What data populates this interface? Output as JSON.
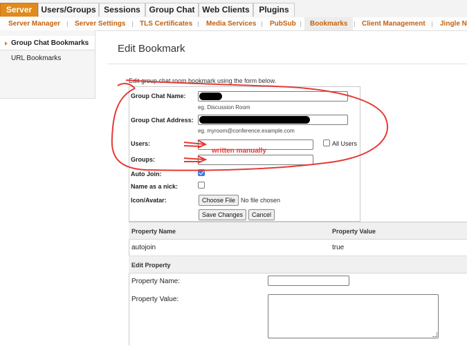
{
  "top_tabs": [
    {
      "label": "Server",
      "active": true
    },
    {
      "label": "Users/Groups",
      "active": false
    },
    {
      "label": "Sessions",
      "active": false
    },
    {
      "label": "Group Chat",
      "active": false
    },
    {
      "label": "Web Clients",
      "active": false
    },
    {
      "label": "Plugins",
      "active": false
    }
  ],
  "sub_tabs": [
    {
      "label": "Server Manager"
    },
    {
      "label": "Server Settings"
    },
    {
      "label": "TLS Certificates"
    },
    {
      "label": "Media Services"
    },
    {
      "label": "PubSub"
    },
    {
      "label": "Bookmarks",
      "active": true
    },
    {
      "label": "Client Management"
    },
    {
      "label": "Jingle No"
    }
  ],
  "sidebar": {
    "items": [
      {
        "label": "Group Chat Bookmarks",
        "active": true
      },
      {
        "label": "URL Bookmarks",
        "active": false
      }
    ]
  },
  "page": {
    "title": "Edit Bookmark",
    "intro": "Edit group chat room bookmark using the form below."
  },
  "form": {
    "name_label": "Group Chat Name:",
    "name_value": "",
    "name_hint": "eg. Discussion Room",
    "address_label": "Group Chat Address:",
    "address_value": "",
    "address_hint": "eg. myroom@conference.example.com",
    "users_label": "Users:",
    "users_value": "",
    "all_users_label": "All Users",
    "all_users_checked": false,
    "groups_label": "Groups:",
    "groups_value": "",
    "autojoin_label": "Auto Join:",
    "autojoin_checked": true,
    "nick_label": "Name as a nick:",
    "nick_checked": false,
    "avatar_label": "Icon/Avatar:",
    "choose_file_label": "Choose File",
    "no_file_text": "No file chosen",
    "save_label": "Save Changes",
    "cancel_label": "Cancel"
  },
  "properties": {
    "columns": [
      "Property Name",
      "Property Value"
    ],
    "rows": [
      {
        "name": "autojoin",
        "value": "true"
      }
    ],
    "edit_heading": "Edit Property",
    "name_field_label": "Property Name:",
    "value_field_label": "Property Value:"
  },
  "annotation": {
    "text": "written manually",
    "color": "#e53935"
  },
  "colors": {
    "accent": "#e08b1c",
    "subtab_text": "#c4610f"
  }
}
